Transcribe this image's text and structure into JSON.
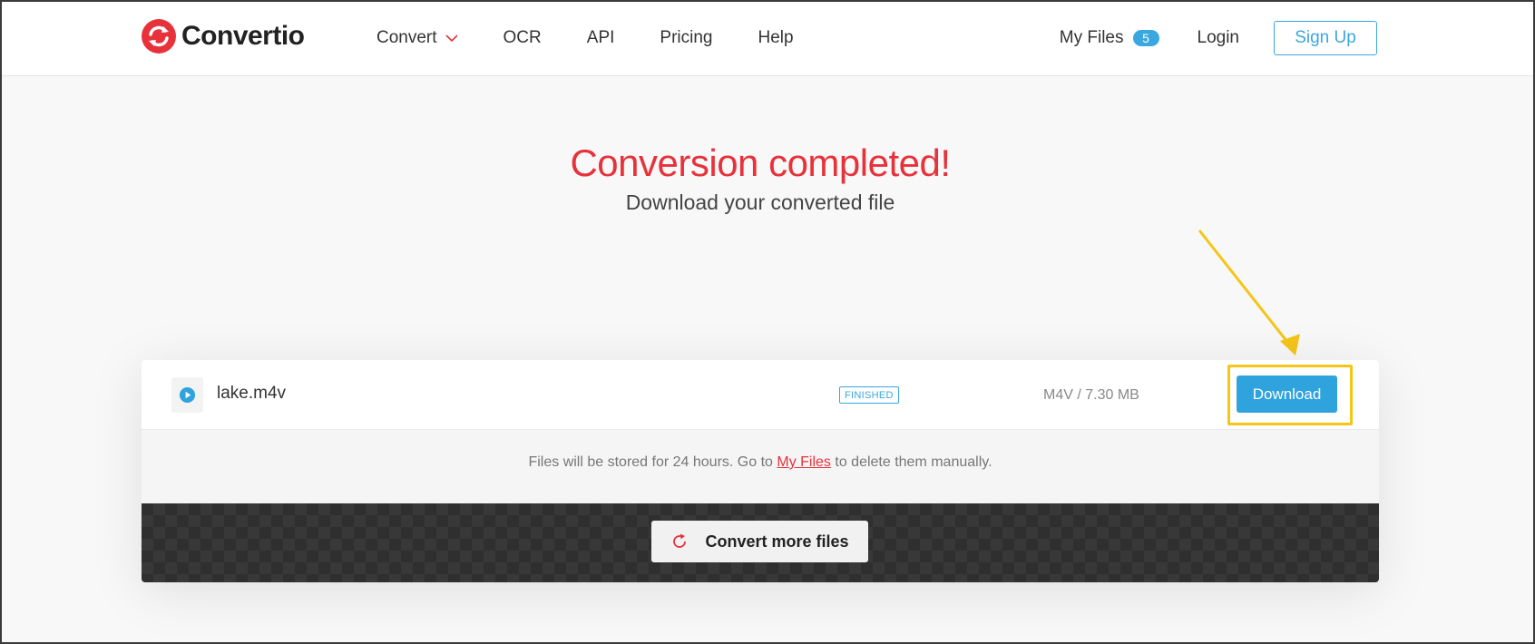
{
  "header": {
    "logo_text": "Convertio",
    "nav": [
      {
        "label": "Convert",
        "has_dropdown": true
      },
      {
        "label": "OCR"
      },
      {
        "label": "API"
      },
      {
        "label": "Pricing"
      },
      {
        "label": "Help"
      }
    ],
    "my_files_label": "My Files",
    "my_files_count": "5",
    "login_label": "Login",
    "signup_label": "Sign Up"
  },
  "hero": {
    "title": "Conversion completed!",
    "subtitle": "Download your converted file"
  },
  "file": {
    "name": "lake.m4v",
    "status": "FINISHED",
    "size": "M4V / 7.30 MB",
    "download_label": "Download",
    "icon": "play-icon"
  },
  "notice": {
    "before": "Files will be stored for 24 hours. Go to ",
    "link": "My Files",
    "after": " to delete them manually."
  },
  "actions": {
    "convert_more_label": "Convert more files",
    "icon": "refresh-icon"
  },
  "colors": {
    "brand_red": "#e8323b",
    "accent_blue": "#2ea3de",
    "highlight_yellow": "#f5c518"
  }
}
